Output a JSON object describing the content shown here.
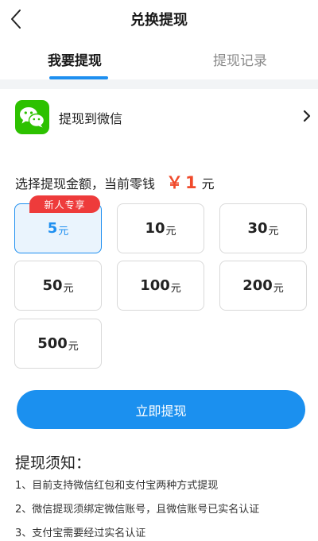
{
  "header": {
    "title": "兑换提现",
    "back_icon": "chevron-left-icon"
  },
  "tabs": [
    {
      "label": "我要提现",
      "active": true
    },
    {
      "label": "提现记录",
      "active": false
    }
  ],
  "method": {
    "label": "提现到微信",
    "icon": "wechat-icon",
    "chevron_icon": "chevron-right-icon"
  },
  "amount": {
    "prompt": "选择提现金额，当前零钱",
    "currency_symbol": "￥",
    "balance": "1",
    "unit": "元"
  },
  "options": [
    {
      "value": "5",
      "unit": "元",
      "selected": true,
      "badge": "新人专享"
    },
    {
      "value": "10",
      "unit": "元",
      "selected": false
    },
    {
      "value": "30",
      "unit": "元",
      "selected": false
    },
    {
      "value": "50",
      "unit": "元",
      "selected": false
    },
    {
      "value": "100",
      "unit": "元",
      "selected": false
    },
    {
      "value": "200",
      "unit": "元",
      "selected": false
    },
    {
      "value": "500",
      "unit": "元",
      "selected": false
    }
  ],
  "submit_label": "立即提现",
  "notice": {
    "title": "提现须知：",
    "items": [
      "1、目前支持微信红包和支付宝两种方式提现",
      "2、微信提现须绑定微信账号，且微信账号已实名认证",
      "3、支付宝需要经过实名认证"
    ]
  },
  "colors": {
    "accent": "#1e8ff0",
    "price": "#f04a2b",
    "badge": "#ee3b3b",
    "wechat": "#2dc100"
  }
}
